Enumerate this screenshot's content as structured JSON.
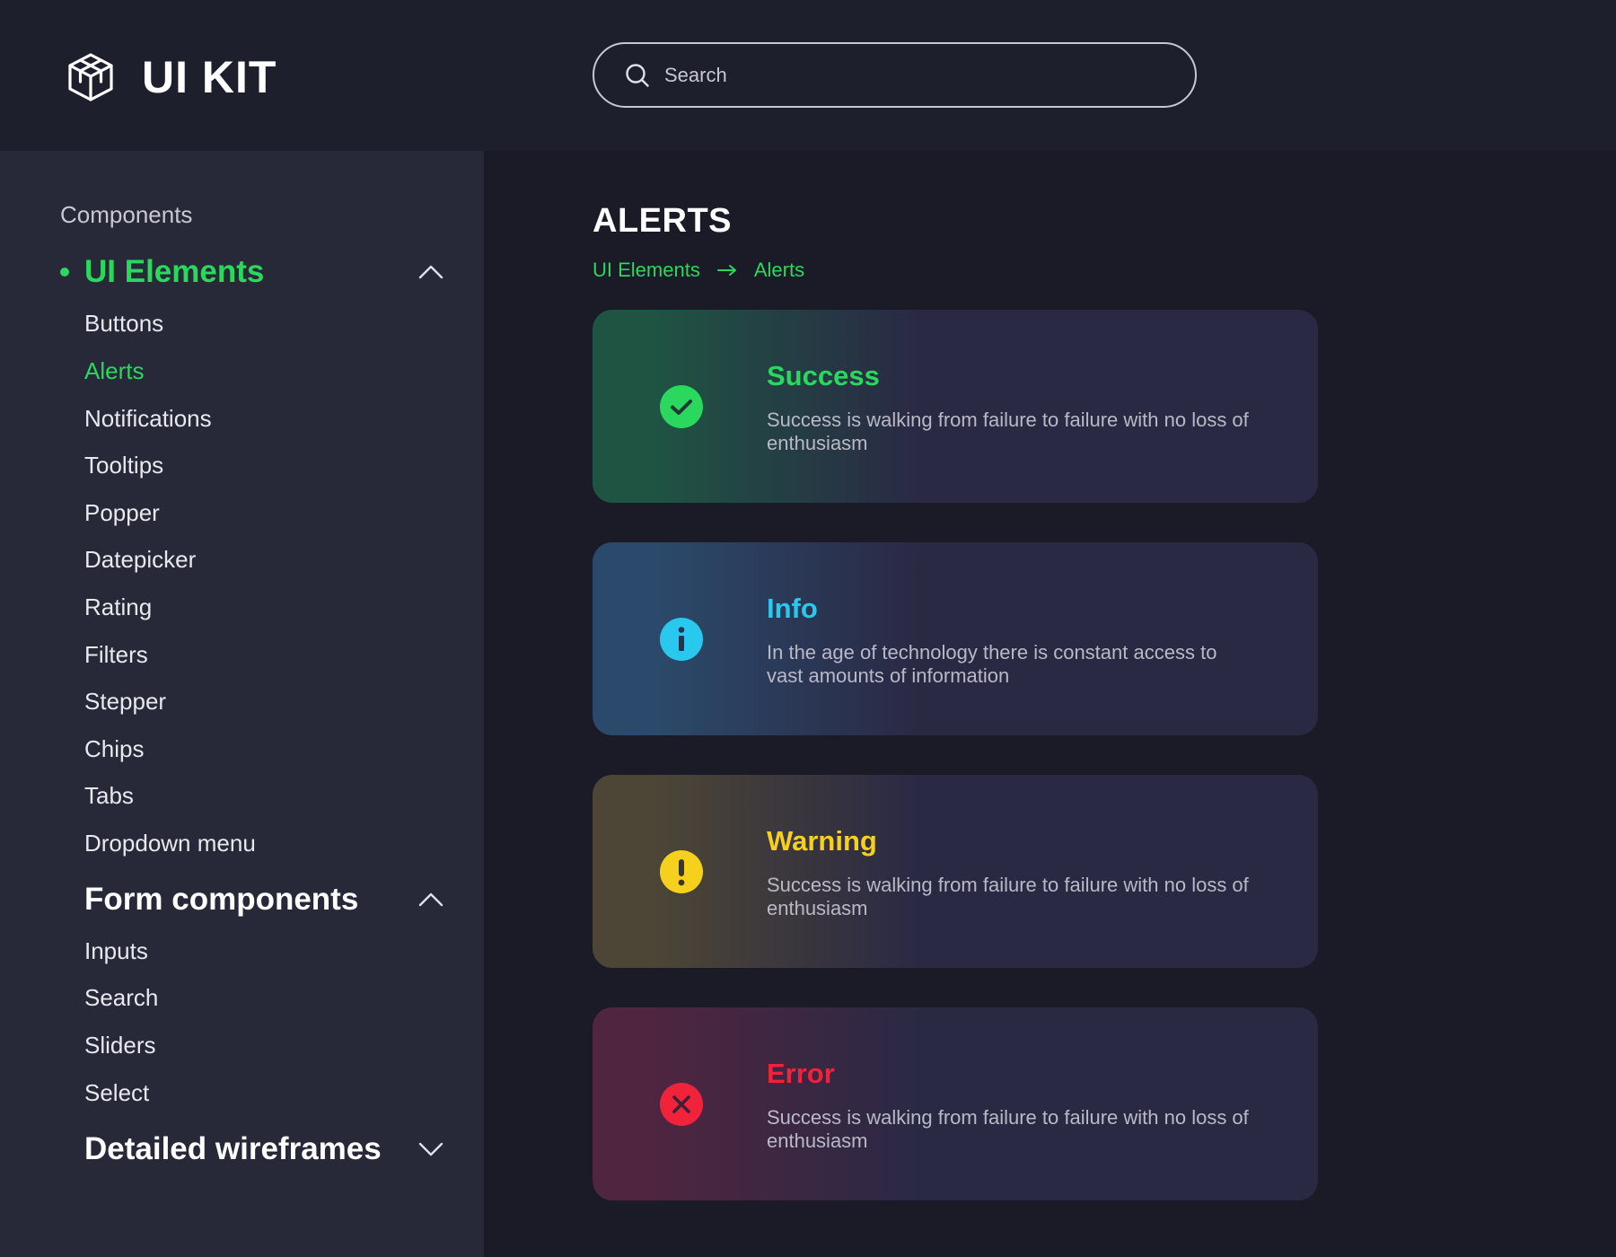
{
  "header": {
    "logo_text": "UI KIT",
    "search_placeholder": "Search"
  },
  "sidebar": {
    "section_title": "Components",
    "groups": [
      {
        "label": "UI Elements",
        "expanded": true,
        "items": [
          "Buttons",
          "Alerts",
          "Notifications",
          "Tooltips",
          "Popper",
          "Datepicker",
          "Rating",
          "Filters",
          "Stepper",
          "Chips",
          "Tabs",
          "Dropdown menu"
        ]
      },
      {
        "label": "Form components",
        "expanded": true,
        "items": [
          "Inputs",
          "Search",
          "Sliders",
          "Select"
        ]
      },
      {
        "label": "Detailed wireframes",
        "expanded": false,
        "items": []
      }
    ],
    "active_item": "Alerts"
  },
  "main": {
    "page_title": "ALERTS",
    "breadcrumb": [
      "UI Elements",
      "Alerts"
    ],
    "alerts": [
      {
        "title": "Success",
        "body": "Success is walking from failure to failure with no loss of enthusiasm",
        "icon": "check-circle-icon",
        "color": "#29d85c",
        "tint": "#1f5443"
      },
      {
        "title": "Info",
        "body": "In the age of technology there is constant access to vast amounts of information",
        "icon": "info-circle-icon",
        "color": "#29c8ee",
        "tint": "#2b4a6b"
      },
      {
        "title": "Warning",
        "body": "Success is walking from failure to failure with no loss of enthusiasm",
        "icon": "exclamation-circle-icon",
        "color": "#f5d11d",
        "tint": "#4d4636"
      },
      {
        "title": "Error",
        "body": "Success is walking from failure to failure with no loss of enthusiasm",
        "icon": "x-circle-icon",
        "color": "#f1233a",
        "tint": "#4f2540"
      }
    ],
    "card_base": "#2a2944"
  },
  "colors": {
    "accent": "#29d85c",
    "background": "#1b1b28",
    "header_bg": "#1e1f2d",
    "sidebar_bg": "#272838"
  }
}
